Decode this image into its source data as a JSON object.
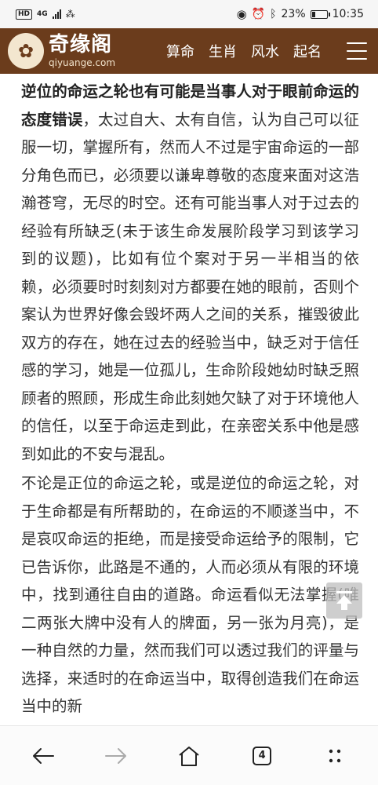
{
  "status_bar": {
    "network": "4G",
    "battery": "23%",
    "battery_level": 0.23,
    "time": "10:35"
  },
  "header": {
    "logo_cn": "奇缘阁",
    "logo_en": "qiyuange.com",
    "nav": [
      "算命",
      "生肖",
      "风水",
      "起名"
    ]
  },
  "article": {
    "p1_bold": "逆位的命运之轮也有可能是当事人对于眼前命运的态度错误",
    "p1_rest": "，太过自大、太有自信，认为自己可以征服一切，掌握所有，然而人不过是宇宙命运的一部分角色而已，必须要以谦卑尊敬的态度来面对这浩瀚苍穹，无尽的时空。还有可能当事人对于过去的经验有所缺乏(未于该生命发展阶段学习到该学习到的议题)，比如有位个案对于另一半相当的依赖，必须要时时刻刻对方都要在她的眼前，否则个案认为世界好像会毁坏两人之间的关系，摧毁彼此双方的存在，她在过去的经验当中，缺乏对于信任感的学习，她是一位孤儿，生命阶段她幼时缺乏照顾者的照顾，形成生命此刻她欠缺了对于环境他人的信任，以至于命运走到此，在亲密关系中他是感到如此的不安与混乱。",
    "p2": "不论是正位的命运之轮，或是逆位的命运之轮，对于生命都是有所帮助的，在命运的不顺遂当中，不是哀叹命运的拒绝，而是接受命运给予的限制，它已告诉你，此路是不通的，人而必须从有限的环境中，找到通往自由的道路。命运看似无法掌握(唯二两张大牌中没有人的牌面，另一张为月亮)，是一种自然的力量，然而我们可以透过我们的评量与选择，来适时的在命运当中，取得创造我们在命运当中的新"
  },
  "bottom_nav": {
    "tab_count": "4"
  },
  "icons": {
    "back": "arrow-left-icon",
    "forward": "arrow-right-icon",
    "home": "home-icon",
    "tabs": "tabs-icon",
    "more": "more-dots-icon",
    "to_top": "back-to-top-icon"
  }
}
